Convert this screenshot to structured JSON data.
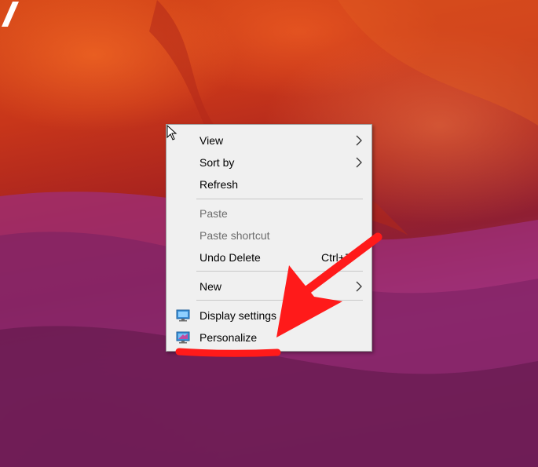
{
  "menu": {
    "items": [
      {
        "label": "View",
        "enabled": true,
        "submenu": true
      },
      {
        "label": "Sort by",
        "enabled": true,
        "submenu": true
      },
      {
        "label": "Refresh",
        "enabled": true
      },
      {
        "label": "Paste",
        "enabled": false
      },
      {
        "label": "Paste shortcut",
        "enabled": false
      },
      {
        "label": "Undo Delete",
        "enabled": true,
        "shortcut": "Ctrl+Z"
      },
      {
        "label": "New",
        "enabled": true,
        "submenu": true
      },
      {
        "label": "Display settings",
        "enabled": true,
        "icon": "monitor-icon"
      },
      {
        "label": "Personalize",
        "enabled": true,
        "icon": "personalize-monitor-icon"
      }
    ]
  },
  "annotation": {
    "color": "#ff1a1a",
    "target": "Personalize"
  },
  "colors": {
    "menu_bg": "#f0f0f0",
    "disabled_text": "#6d6d6d"
  }
}
